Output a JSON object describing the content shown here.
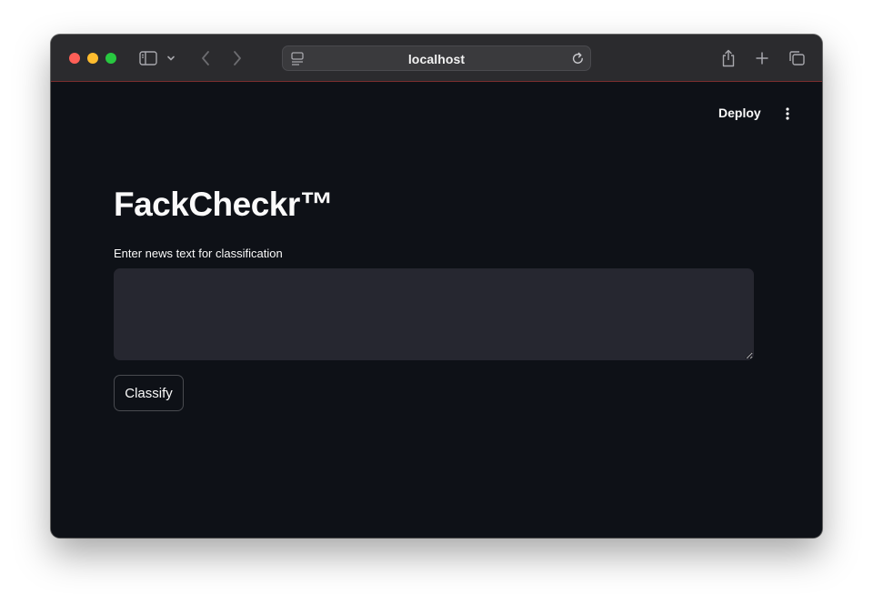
{
  "browser": {
    "url": "localhost",
    "icons": {
      "sidebar": "sidebar-toggle-icon",
      "tab_overview_menu": "chevron-down-icon",
      "back": "back-arrow-icon",
      "forward": "forward-arrow-icon",
      "site": "site-settings-icon",
      "reload": "reload-icon",
      "share": "share-icon",
      "new_tab": "plus-icon",
      "tabs": "tabs-overview-icon"
    },
    "traffic_lights": {
      "close": "#ff5f57",
      "minimize": "#febc2e",
      "zoom": "#28c840"
    }
  },
  "header": {
    "deploy_label": "Deploy",
    "menu_icon": "kebab-menu-icon"
  },
  "main": {
    "title": "FackCheckr™",
    "input_label": "Enter news text for classification",
    "input_value": "",
    "button_label": "Classify"
  },
  "colors": {
    "app_background": "#0e1117",
    "input_background": "#262730",
    "text": "#fafafa",
    "browser_chrome": "#2b2b2e"
  }
}
